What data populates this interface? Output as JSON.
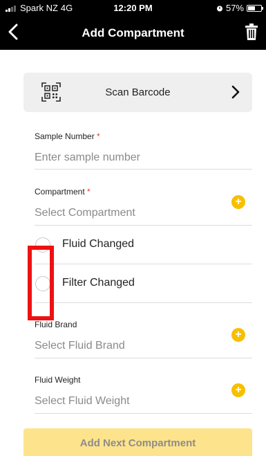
{
  "status_bar": {
    "carrier": "Spark NZ",
    "network": "4G",
    "time": "12:20 PM",
    "battery": "57%",
    "battery_fraction": 0.57
  },
  "nav": {
    "title": "Add Compartment",
    "back_icon": "chevron-left-icon",
    "trash_icon": "trash-icon"
  },
  "scan": {
    "label": "Scan Barcode",
    "icon": "qr-code-icon"
  },
  "fields": {
    "sample_number": {
      "label": "Sample Number",
      "required_mark": "*",
      "placeholder": "Enter sample number"
    },
    "compartment": {
      "label": "Compartment",
      "required_mark": "*",
      "placeholder": "Select Compartment",
      "add_symbol": "+"
    },
    "fluid_changed": {
      "label": "Fluid Changed"
    },
    "filter_changed": {
      "label": "Filter Changed"
    },
    "fluid_brand": {
      "label": "Fluid Brand",
      "placeholder": "Select Fluid Brand",
      "add_symbol": "+"
    },
    "fluid_weight": {
      "label": "Fluid Weight",
      "placeholder": "Select Fluid Weight",
      "add_symbol": "+"
    }
  },
  "add_next": {
    "label": "Add Next Compartment"
  },
  "colors": {
    "accent": "#f6c000",
    "button_bg": "#fde38c",
    "highlight": "#ee1111",
    "header_bg": "#000000"
  }
}
